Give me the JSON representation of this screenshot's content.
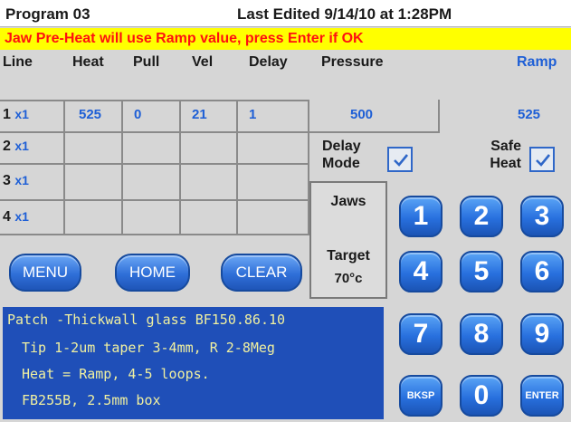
{
  "title_bar": {
    "program": "Program 03",
    "last_edited": "Last Edited 9/14/10 at 1:28PM"
  },
  "warning": "Jaw Pre-Heat will use Ramp value, press Enter if OK",
  "table": {
    "headers": {
      "line": "Line",
      "heat": "Heat",
      "pull": "Pull",
      "vel": "Vel",
      "delay": "Delay",
      "pressure": "Pressure",
      "ramp": "Ramp"
    },
    "rows": [
      {
        "num": "1",
        "mult": "x1",
        "heat": "525",
        "pull": "0",
        "vel": "21",
        "delay": "1",
        "pressure": "500"
      },
      {
        "num": "2",
        "mult": "x1"
      },
      {
        "num": "3",
        "mult": "x1"
      },
      {
        "num": "4",
        "mult": "x1"
      }
    ],
    "ramp_value": "525"
  },
  "options": {
    "delay_mode": {
      "line1": "Delay",
      "line2": "Mode",
      "checked": true
    },
    "safe_heat": {
      "line1": "Safe",
      "line2": "Heat",
      "checked": true
    }
  },
  "jaws": {
    "title": "Jaws",
    "target_label": "Target",
    "target_value": "70°c"
  },
  "buttons": {
    "menu": "MENU",
    "home": "HOME",
    "clear": "CLEAR"
  },
  "info_lines": [
    "Patch -Thickwall glass BF150.86.10",
    "Tip 1-2um taper 3-4mm, R 2-8Meg",
    "Heat = Ramp, 4-5 loops.",
    "FB255B, 2.5mm box"
  ],
  "keypad": [
    "1",
    "2",
    "3",
    "4",
    "5",
    "6",
    "7",
    "8",
    "9",
    "BKSP",
    "0",
    "ENTER"
  ],
  "colors": {
    "accent": "#1e5fd6",
    "warning_bg": "#ffff00",
    "warning_text": "#ff1010",
    "info_bg": "#1f4fb8",
    "info_text": "#f0f0a0"
  }
}
